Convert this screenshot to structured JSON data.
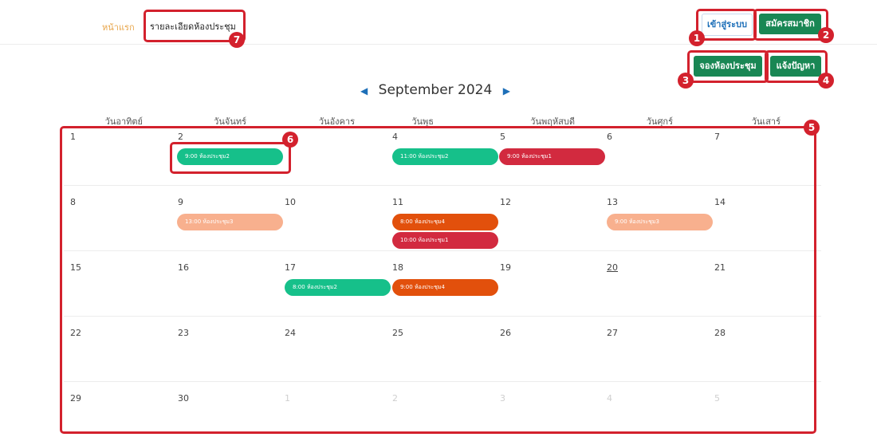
{
  "nav": {
    "home": "หน้าแรก",
    "detail": "รายละเอียดห้องประชุม"
  },
  "buttons": {
    "login": "เข้าสู่ระบบ",
    "register": "สมัครสมาชิก",
    "book": "จองห้องประชุม",
    "report": "แจ้งปัญหา"
  },
  "calendar": {
    "month_label": "September 2024",
    "weekdays": [
      "วันอาทิตย์",
      "วันจันทร์",
      "วันอังคาร",
      "วันพุธ",
      "วันพฤหัสบดี",
      "วันศุกร์",
      "วันเสาร์"
    ],
    "weeks": [
      [
        "1",
        "2",
        "3",
        "4",
        "5",
        "6",
        "7"
      ],
      [
        "8",
        "9",
        "10",
        "11",
        "12",
        "13",
        "14"
      ],
      [
        "15",
        "16",
        "17",
        "18",
        "19",
        "20",
        "21"
      ],
      [
        "22",
        "23",
        "24",
        "25",
        "26",
        "27",
        "28"
      ],
      [
        "29",
        "30",
        "1",
        "2",
        "3",
        "4",
        "5"
      ]
    ],
    "events": [
      {
        "label": "9:00 ห้องประชุม2",
        "color": "#16c08a"
      },
      {
        "label": "11:00 ห้องประชุม2",
        "color": "#16c08a"
      },
      {
        "label": "9:00 ห้องประชุม1",
        "color": "#d22a3f"
      },
      {
        "label": "13:00 ห้องประชุม3",
        "color": "#f8b08e"
      },
      {
        "label": "8:00 ห้องประชุม4",
        "color": "#e2500c"
      },
      {
        "label": "10:00 ห้องประชุม1",
        "color": "#d22a3f"
      },
      {
        "label": "9:00 ห้องประชุม3",
        "color": "#f8b08e"
      },
      {
        "label": "8:00 ห้องประชุม2",
        "color": "#16c08a"
      },
      {
        "label": "9:00 ห้องประชุม4",
        "color": "#e2500c"
      }
    ]
  },
  "annotations": [
    "1",
    "2",
    "3",
    "4",
    "5",
    "6",
    "7"
  ]
}
